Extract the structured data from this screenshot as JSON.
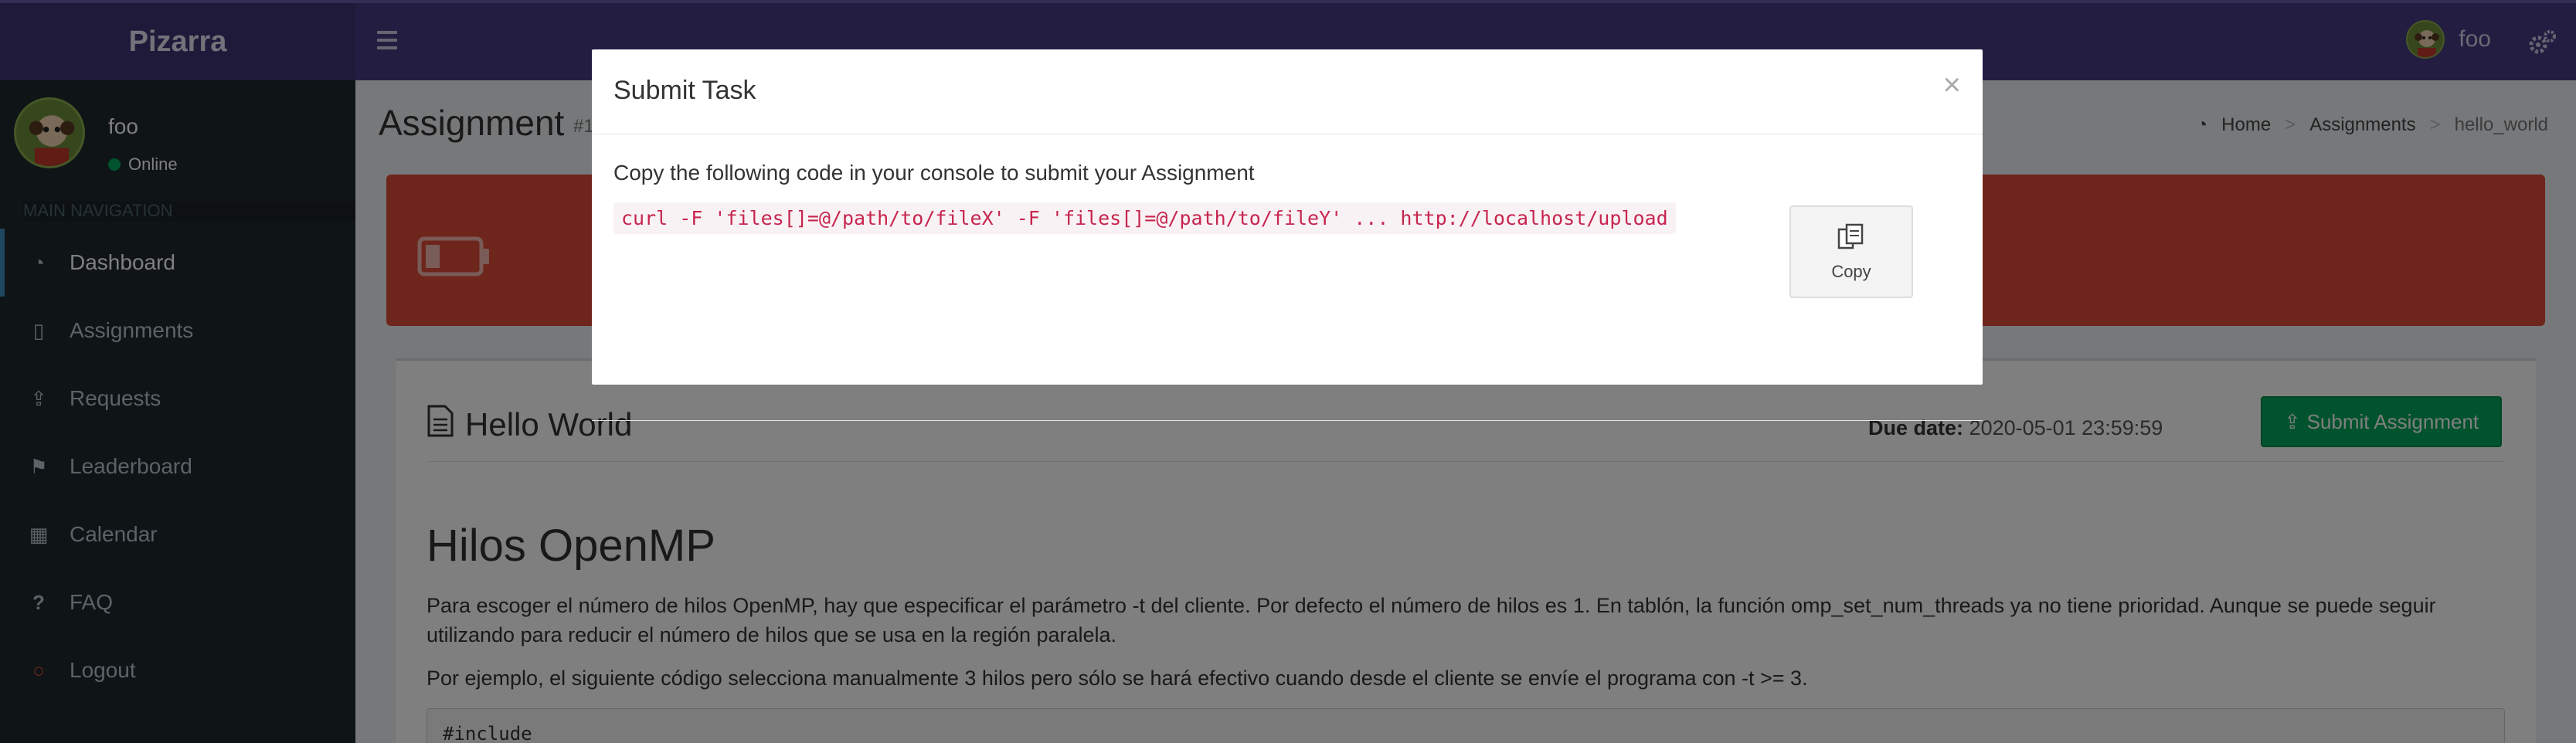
{
  "app": {
    "brand": "Pizarra",
    "user": "foo",
    "status": "Online"
  },
  "sidebar": {
    "header": "MAIN NAVIGATION",
    "items": [
      {
        "label": "Dashboard",
        "icon": "dashboard-icon"
      },
      {
        "label": "Assignments",
        "icon": "file-icon"
      },
      {
        "label": "Requests",
        "icon": "upload-icon"
      },
      {
        "label": "Leaderboard",
        "icon": "flag-icon"
      },
      {
        "label": "Calendar",
        "icon": "calendar-icon"
      },
      {
        "label": "FAQ",
        "icon": "question-icon"
      },
      {
        "label": "Logout",
        "icon": "power-icon"
      }
    ]
  },
  "page": {
    "title": "Assignment",
    "subtitle": "#1",
    "breadcrumb": [
      "Home",
      "Assignments",
      "hello_world"
    ]
  },
  "task": {
    "title": "Hello World",
    "due_label": "Due date:",
    "due_value": "2020-05-01 23:59:59",
    "submit_label": "Submit Assignment",
    "heading": "Hilos OpenMP",
    "paragraph1": "Para escoger el número de hilos OpenMP, hay que especificar el parámetro -t del cliente. Por defecto el número de hilos es 1. En tablón, la función omp_set_num_threads ya no tiene prioridad. Aunque se puede seguir utilizando para reducir el número de hilos que se usa en la región paralela.",
    "paragraph2": "Por ejemplo, el siguiente código selecciona manualmente 3 hilos pero sólo se hará efectivo cuando desde el cliente se envíe el programa con -t >= 3.",
    "code": "#include"
  },
  "modal": {
    "title": "Submit Task",
    "close": "×",
    "instruction": "Copy the following code in your console to submit your Assignment",
    "command": "curl -F 'files[]=@/path/to/fileX' -F 'files[]=@/path/to/fileY' ... http://localhost/upload",
    "copy_label": "Copy"
  },
  "colors": {
    "header": "#473c82",
    "sidebar": "#1e282c",
    "alert": "#dd4b39",
    "submit": "#00a65a",
    "code_text": "#c7254e"
  }
}
